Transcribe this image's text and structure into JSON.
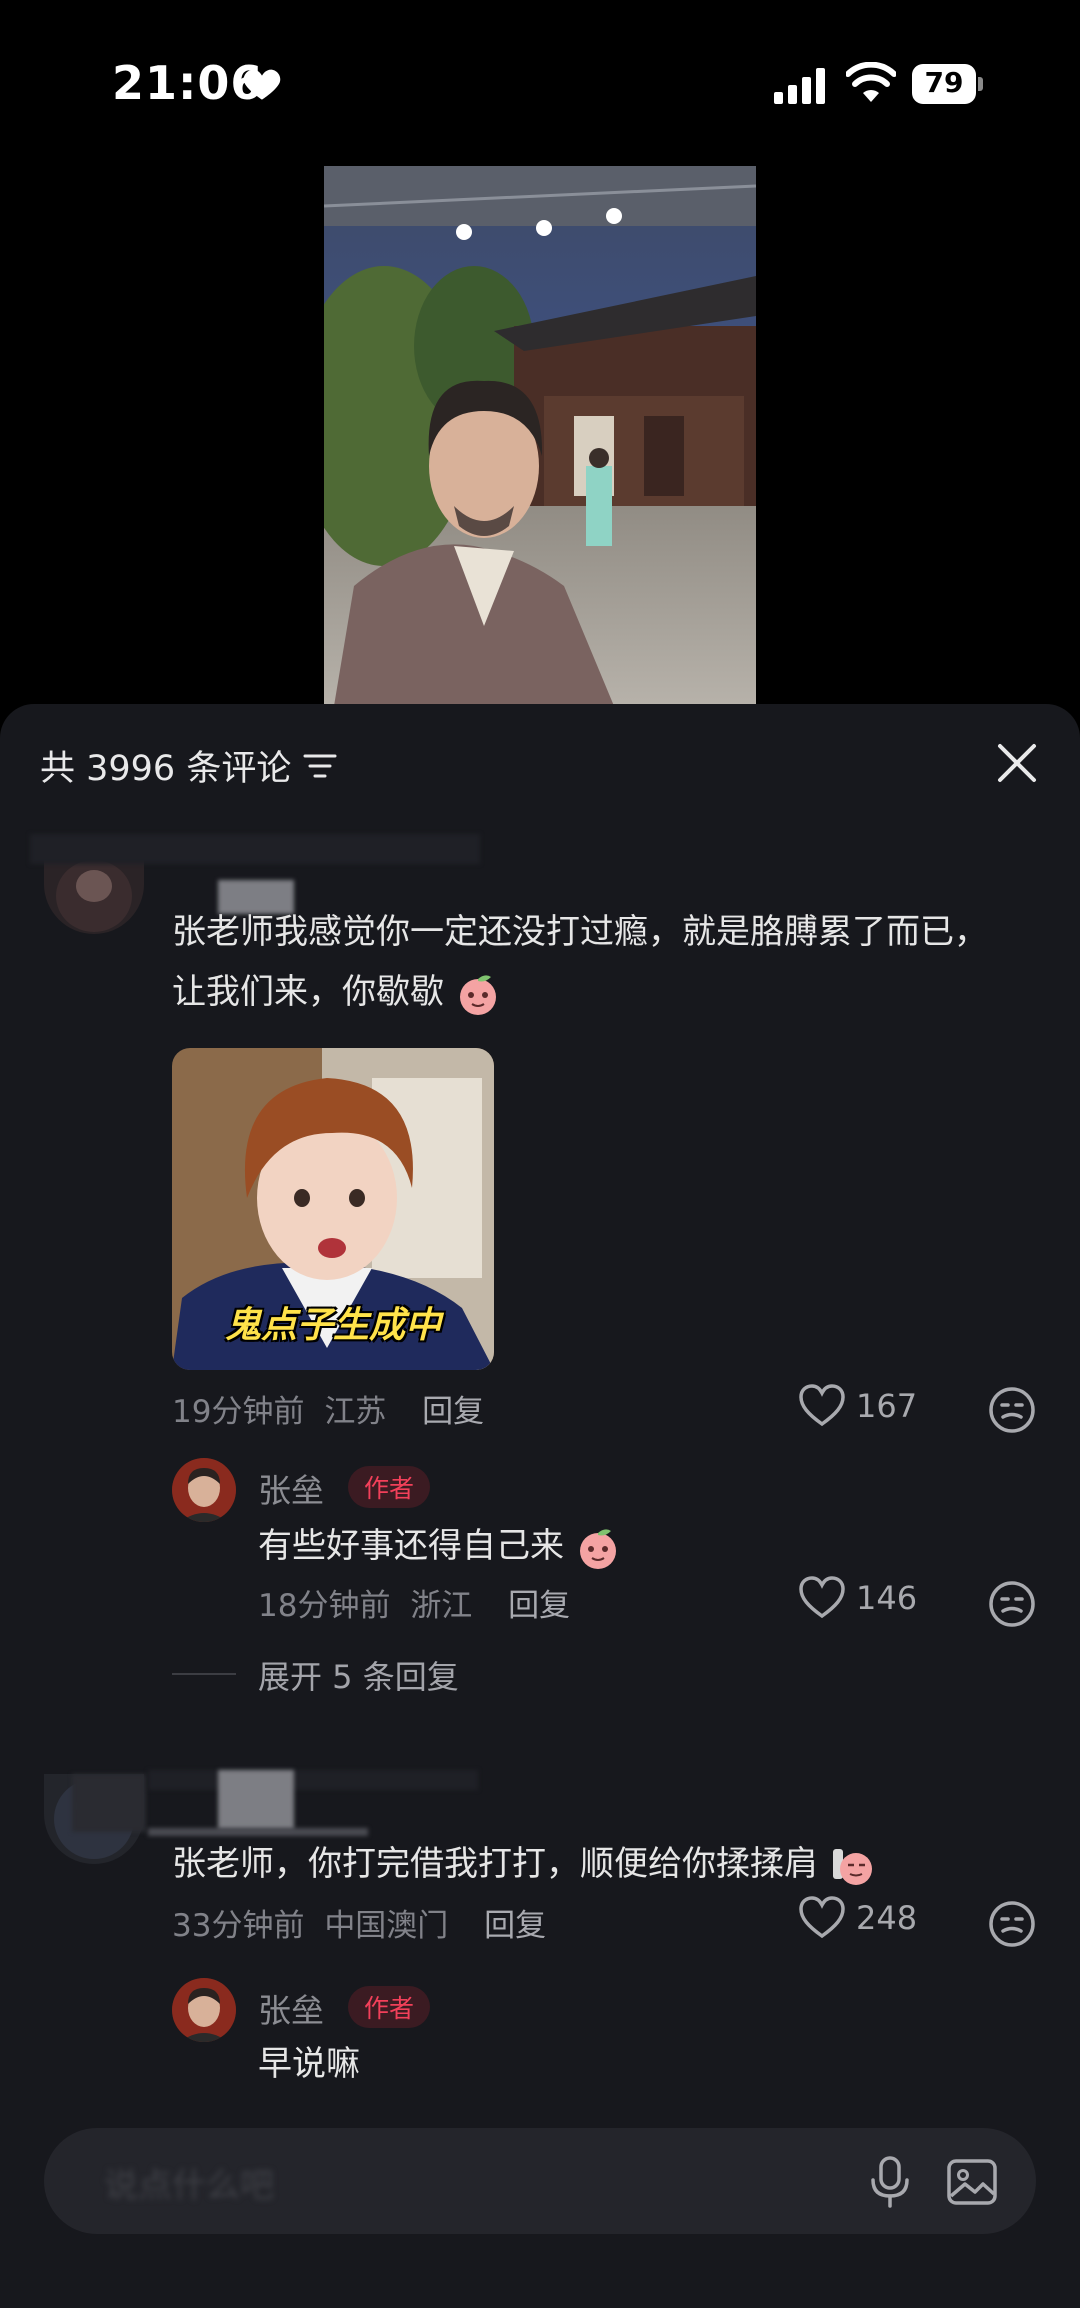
{
  "status_bar": {
    "time": "21:06",
    "battery": "79"
  },
  "comments_sheet": {
    "title": "共 3996 条评论",
    "comments": [
      {
        "text": "张老师我感觉你一定还没打过瘾，就是胳膊累了而已，让我们来，你歇歇",
        "meme_caption": "鬼点子生成中",
        "time": "19分钟前",
        "location": "江苏",
        "reply_label": "回复",
        "likes": "167",
        "author_reply": {
          "name": "张垒",
          "badge": "作者",
          "text": "有些好事还得自己来",
          "time": "18分钟前",
          "location": "浙江",
          "reply_label": "回复",
          "likes": "146"
        },
        "expand_label": "展开 5 条回复"
      },
      {
        "text": "张老师，你打完借我打打，顺便给你揉揉肩",
        "time": "33分钟前",
        "location": "中国澳门",
        "reply_label": "回复",
        "likes": "248",
        "author_reply": {
          "name": "张垒",
          "badge": "作者",
          "text": "早说嘛"
        }
      }
    ]
  },
  "input_bar": {
    "placeholder": "说点什么吧"
  },
  "colors": {
    "sheet_bg": "#17181d",
    "author_badge": "#f2405a",
    "meta_text": "#818289"
  }
}
